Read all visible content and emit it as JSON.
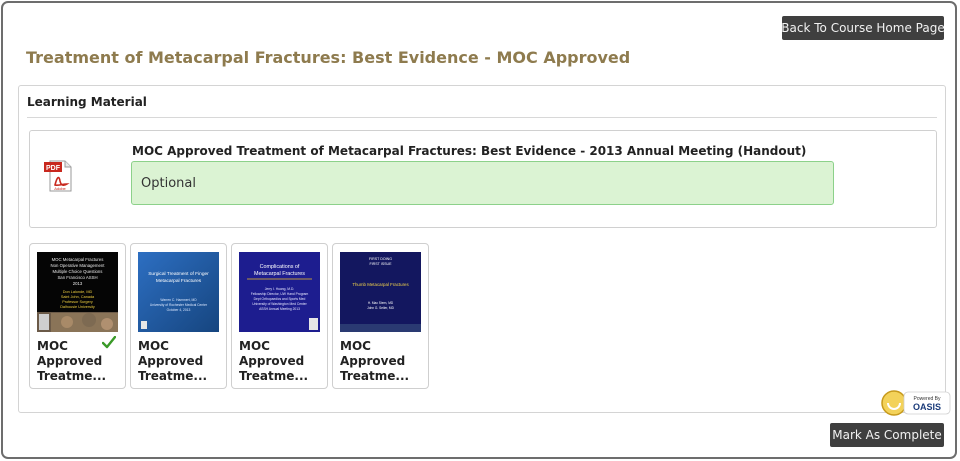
{
  "header": {
    "back_button": "Back To Course Home Page",
    "page_title": "Treatment of Metacarpal Fractures: Best Evidence - MOC Approved"
  },
  "learning_material": {
    "heading": "Learning Material",
    "item": {
      "icon": "pdf-icon",
      "icon_text": "PDF",
      "icon_brand": "Adobe",
      "title": "MOC Approved Treatment of Metacarpal Fractures: Best Evidence - 2013 Annual Meeting (Handout)",
      "status": "Optional"
    }
  },
  "modules": [
    {
      "line1": "MOC",
      "line2": "Approved",
      "line3": "Treatme...",
      "completed": true,
      "slide_title": [
        "MOC Metacarpal Fractures",
        "Non Operative Management",
        "Multiple Choice Questions",
        "San Francisco ASSH",
        "2013"
      ],
      "slide_authors": [
        "Don Lalonde, MD",
        "Saint John, Canada",
        "Professor Surgery",
        "Dalhousie University"
      ]
    },
    {
      "line1": "MOC",
      "line2": "Approved",
      "line3": "Treatme...",
      "completed": false,
      "slide_title": [
        "Surgical Treatment of Finger",
        "Metacarpal Fractures"
      ],
      "slide_authors": [
        "Warren C. Hammert, MD",
        "University of Rochester Medical Center",
        "October 4, 2013"
      ]
    },
    {
      "line1": "MOC",
      "line2": "Approved",
      "line3": "Treatme...",
      "completed": false,
      "slide_title": [
        "Complications of",
        "Metacarpal Fractures"
      ],
      "slide_authors": [
        "Jerry I. Huang, M.D.",
        "Fellowship Director, UW Hand Program",
        "Dept Orthopaedics and Sports Med",
        "University of Washington Med Center",
        "ASSH Annual Meeting 2013"
      ]
    },
    {
      "line1": "MOC",
      "line2": "Approved",
      "line3": "Treatme...",
      "completed": false,
      "slide_title": [
        "Thumb Metacarpal Fractures"
      ],
      "slide_banner": [
        "FIRST DOING",
        "FIRST ISSUE"
      ],
      "slide_authors": [
        "H. Mac Stern, MD",
        "John G. Seiler, MD"
      ]
    }
  ],
  "footer": {
    "mark_button": "Mark As Complete",
    "badge_small": "Powered By",
    "badge_big": "OASIS"
  },
  "colors": {
    "title_gold": "#8e7b4e",
    "button_dark": "#3f3f3f",
    "optional_bg": "#dbf3d3",
    "optional_border": "#8cd18a",
    "check_green": "#3a9a28"
  }
}
